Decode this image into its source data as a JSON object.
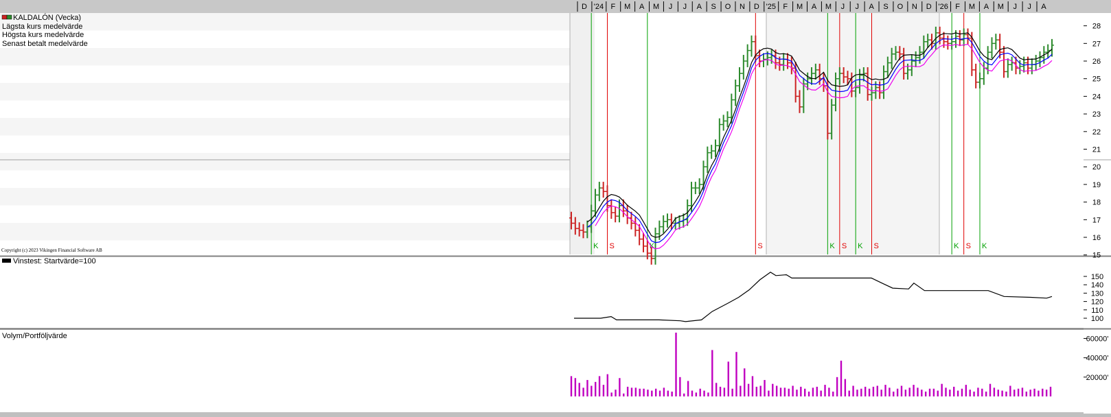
{
  "panel_top": {
    "title": "KALDALÓN (Vecka)",
    "legend": [
      "Lägsta kurs medelvärde",
      "Högsta kurs medelvärde",
      "Senast betalt medelvärde"
    ],
    "copyright": "Copyright (c) 2023 Vikingen Financial Software AB"
  },
  "panel_mid": {
    "legend": "Vinstest: Startvärde=100"
  },
  "panel_bottom": {
    "legend": "Volym/Portföljvärde"
  },
  "colors": {
    "up": "#2e8b2e",
    "down": "#cc2222",
    "signal_buy": "#00a000",
    "signal_sell": "#e00000",
    "ma_low": "#ee00ee",
    "ma_high": "#000000",
    "ma_close": "#0000ff",
    "volume": "#c000c0"
  },
  "chart_data": [
    {
      "type": "ohlc",
      "title": "KALDALÓN (Vecka)",
      "x_tick_labels": [
        "D",
        "'24",
        "F",
        "M",
        "A",
        "M",
        "J",
        "J",
        "A",
        "S",
        "O",
        "N",
        "D",
        "'25",
        "F",
        "M",
        "A",
        "M",
        "J",
        "J",
        "A",
        "S",
        "O",
        "N",
        "D",
        "'26",
        "F",
        "M",
        "A",
        "M",
        "J",
        "J",
        "A"
      ],
      "y_ticks": [
        15,
        16,
        17,
        18,
        19,
        20,
        21,
        22,
        23,
        24,
        25,
        26,
        27,
        28
      ],
      "ylim": [
        14.4,
        28
      ],
      "close_series": [
        16.8,
        16.5,
        16.4,
        16.3,
        16.6,
        17.5,
        18.4,
        18.8,
        18.6,
        17.8,
        17.4,
        17.2,
        17.8,
        17.5,
        17.1,
        16.8,
        16.4,
        15.9,
        15.5,
        15.1,
        14.8,
        16.2,
        16.6,
        16.9,
        17.0,
        16.8,
        16.8,
        16.9,
        17.0,
        17.8,
        18.8,
        18.8,
        19.0,
        20.0,
        20.8,
        20.9,
        21.2,
        22.4,
        22.6,
        22.8,
        23.8,
        24.6,
        25.3,
        26.0,
        26.6,
        27.1,
        26.3,
        26.0,
        26.1,
        26.2,
        26.3,
        25.9,
        25.8,
        26.1,
        25.9,
        25.6,
        24.0,
        23.4,
        24.7,
        25.0,
        25.3,
        25.5,
        25.0,
        24.6,
        21.9,
        23.5,
        25.0,
        25.3,
        25.1,
        25.0,
        24.3,
        24.5,
        25.2,
        25.3,
        24.1,
        24.2,
        24.5,
        24.2,
        25.4,
        25.9,
        26.4,
        26.5,
        26.4,
        25.3,
        25.5,
        26.0,
        26.2,
        26.5,
        27.1,
        27.2,
        27.0,
        27.6,
        27.3,
        27.1,
        27.0,
        27.1,
        27.4,
        27.2,
        27.5,
        27.3,
        25.5,
        24.8,
        25.0,
        25.6,
        26.5,
        27.0,
        27.2,
        26.5,
        25.4,
        25.8,
        25.9,
        25.6,
        25.7,
        25.9,
        25.6,
        25.8,
        26.0,
        26.2,
        26.5,
        26.6,
        26.9
      ],
      "signals": [
        {
          "week": 5,
          "type": "K"
        },
        {
          "week": 9,
          "type": "S"
        },
        {
          "week": 19,
          "type": "K"
        },
        {
          "week": 46,
          "type": "S"
        },
        {
          "week": 64,
          "type": "K"
        },
        {
          "week": 67,
          "type": "S"
        },
        {
          "week": 71,
          "type": "K"
        },
        {
          "week": 75,
          "type": "S"
        },
        {
          "week": 95,
          "type": "K"
        },
        {
          "week": 98,
          "type": "S"
        },
        {
          "week": 102,
          "type": "K"
        }
      ]
    },
    {
      "type": "line",
      "name": "Vinstest: Startvärde=100",
      "y_ticks": [
        100,
        110,
        120,
        130,
        140,
        150
      ],
      "ylim": [
        95,
        157
      ],
      "points": [
        [
          0,
          100
        ],
        [
          5,
          100
        ],
        [
          7,
          102
        ],
        [
          8,
          98
        ],
        [
          16,
          98
        ],
        [
          20,
          97
        ],
        [
          21,
          96
        ],
        [
          24,
          98
        ],
        [
          26,
          108
        ],
        [
          29,
          118
        ],
        [
          31,
          125
        ],
        [
          33,
          134
        ],
        [
          35,
          146
        ],
        [
          37,
          155
        ],
        [
          38,
          151
        ],
        [
          40,
          152
        ],
        [
          41,
          148
        ],
        [
          50,
          148
        ],
        [
          56,
          148
        ],
        [
          58,
          142
        ],
        [
          60,
          136
        ],
        [
          63,
          135
        ],
        [
          64,
          142
        ],
        [
          66,
          133
        ],
        [
          78,
          133
        ],
        [
          81,
          126
        ],
        [
          86,
          125
        ],
        [
          89,
          124
        ],
        [
          90,
          126
        ]
      ]
    },
    {
      "type": "bar",
      "name": "Volym/Portföljvärde",
      "y_ticks": [
        "20000'",
        "40000'",
        "60000'"
      ],
      "ylim": [
        0,
        66000
      ],
      "values": [
        21000,
        19000,
        14000,
        9000,
        17000,
        11000,
        15000,
        21000,
        12000,
        23000,
        4000,
        7000,
        19000,
        3000,
        10000,
        9000,
        9000,
        8000,
        8000,
        7000,
        6000,
        8000,
        6000,
        9000,
        6000,
        5000,
        66000,
        20000,
        3000,
        16000,
        6000,
        4000,
        8000,
        6000,
        4000,
        48000,
        14000,
        10000,
        9000,
        36000,
        8000,
        46000,
        11000,
        29000,
        13000,
        21000,
        10000,
        11000,
        17000,
        6000,
        13000,
        11000,
        9000,
        9000,
        8000,
        11000,
        7000,
        10000,
        8000,
        5000,
        9000,
        10000,
        6000,
        12000,
        9000,
        5000,
        20000,
        37000,
        18000,
        6000,
        11000,
        7000,
        8000,
        10000,
        8000,
        10000,
        11000,
        7000,
        12000,
        9000,
        5000,
        8000,
        11000,
        7000,
        9000,
        12000,
        9000,
        7000,
        5000,
        8000,
        8000,
        6000,
        13000,
        9000,
        7000,
        10000,
        6000,
        8000,
        12000,
        7000,
        5000,
        9000,
        8000,
        5000,
        13000,
        9000,
        7000,
        6000,
        5000,
        11000,
        7000,
        8000,
        9000,
        5000,
        7000,
        8000,
        6000,
        8000,
        7000,
        10000
      ]
    }
  ]
}
